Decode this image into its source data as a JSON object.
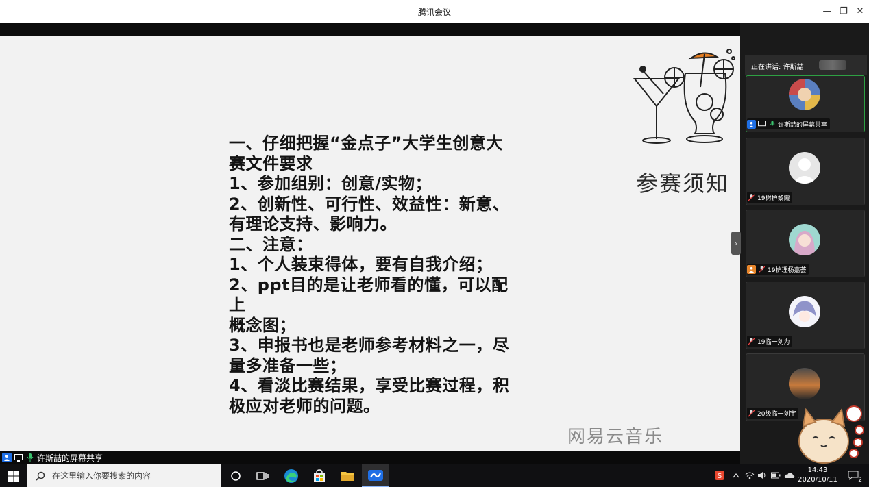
{
  "window": {
    "title": "腾讯会议",
    "minimize_label": "—",
    "restore_label": "❐",
    "close_label": "✕"
  },
  "slide": {
    "lines": [
      "一、仔细把握“金点子”大学生创意大",
      "赛文件要求",
      "1、参加组别：创意/实物；",
      "2、创新性、可行性、效益性：新意、",
      "有理论支持、影响力。",
      "二、注意：",
      "1、个人装束得体，要有自我介绍；",
      "2、ppt目的是让老师看的懂，可以配上",
      "概念图；",
      "3、申报书也是老师参考材料之一，尽",
      "量多准备一些；",
      "4、看淡比赛结果，享受比赛过程，积",
      "极应对老师的问题。"
    ],
    "heading": "参赛须知",
    "watermark": "网易云音乐"
  },
  "share_bar": {
    "label": "许斯喆的屏幕共享"
  },
  "panel": {
    "speaking_label": "正在讲话: 许斯喆",
    "participants": [
      {
        "name": "许斯喆的屏幕共享",
        "active": true
      },
      {
        "name": "19树护黎霞",
        "active": false
      },
      {
        "name": "19护理杨嘉荟",
        "active": false
      },
      {
        "name": "19临一刘为",
        "active": false
      },
      {
        "name": "20级临一刘宇",
        "active": false
      }
    ]
  },
  "taskbar": {
    "search_placeholder": "在这里输入你要搜索的内容",
    "time": "14:43",
    "date": "2020/10/11",
    "notification_count": "2"
  },
  "colors": {
    "active_border": "#2ea043",
    "user_badge": "#1f6fe5",
    "mic_green": "#3ac26e"
  }
}
